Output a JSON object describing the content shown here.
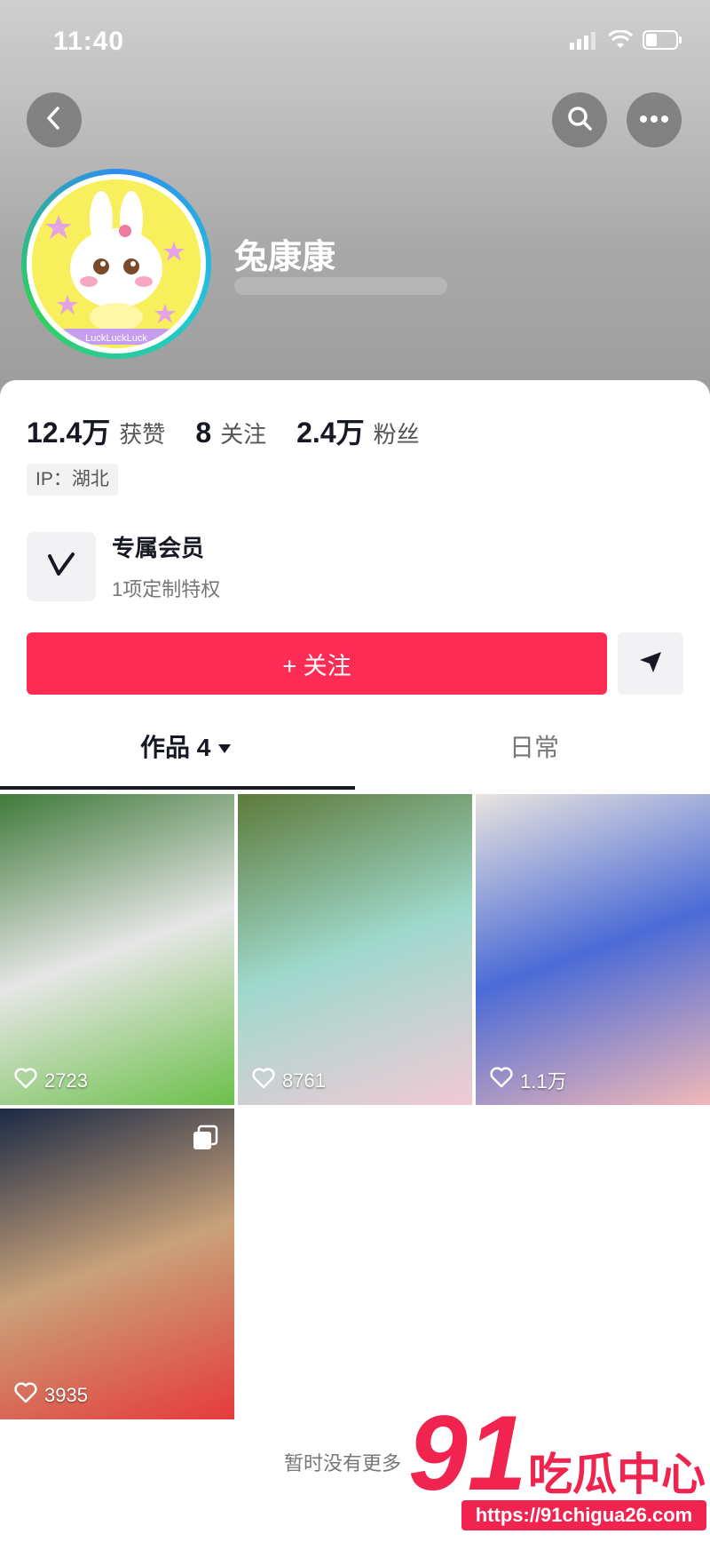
{
  "status_bar": {
    "time": "11:40"
  },
  "profile": {
    "name": "兔康康",
    "avatar_text": "LuckLuckLuck"
  },
  "stats": [
    {
      "value": "12.4万",
      "label": "获赞"
    },
    {
      "value": "8",
      "label": "关注"
    },
    {
      "value": "2.4万",
      "label": "粉丝"
    }
  ],
  "ip": "IP：湖北",
  "membership": {
    "title": "专属会员",
    "subtitle": "1项定制特权"
  },
  "actions": {
    "follow_label": "+ 关注"
  },
  "tabs": [
    {
      "label": "作品 4",
      "active": true
    },
    {
      "label": "日常",
      "active": false
    }
  ],
  "videos": [
    {
      "likes": "2723",
      "colors": [
        "#3f7a3a",
        "#e6e6e6",
        "#6cc04a"
      ]
    },
    {
      "likes": "8761",
      "colors": [
        "#5d7a3a",
        "#9fd9cc",
        "#f1c9d6"
      ]
    },
    {
      "likes": "1.1万",
      "colors": [
        "#e9e4df",
        "#4b6bd6",
        "#f0b8b8"
      ]
    },
    {
      "likes": "3935",
      "colors": [
        "#1b2a45",
        "#c9a27a",
        "#e63b3b"
      ]
    }
  ],
  "footer": {
    "no_more": "暂时没有更多"
  },
  "watermark": {
    "big": "91",
    "brand": "吃瓜中心",
    "url": "https://91chigua26.com"
  },
  "theme": {
    "accent": "#fe2c55"
  }
}
